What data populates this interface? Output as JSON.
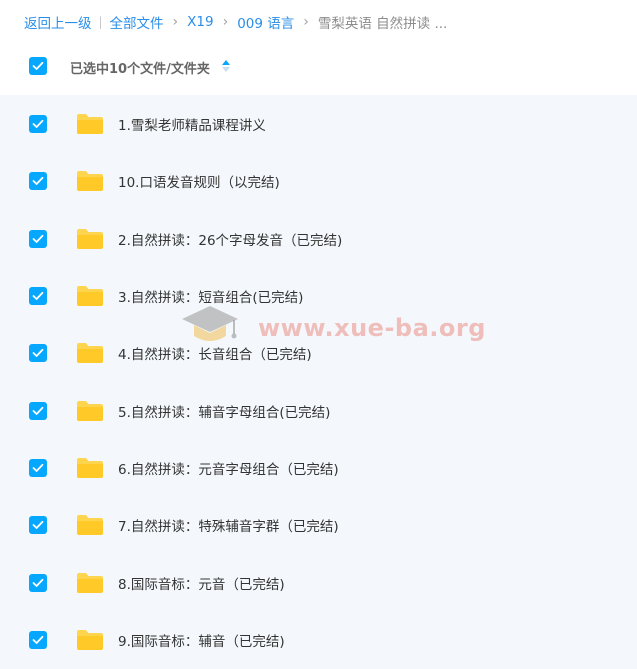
{
  "breadcrumb": {
    "back": "返回上一级",
    "all_files": "全部文件",
    "level1": "X19",
    "level2": "009 语言",
    "current": "雪梨英语 自然拼读 ..."
  },
  "selection": {
    "label": "已选中10个文件/文件夹",
    "checked": true
  },
  "files": [
    {
      "name": "1.雪梨老师精品课程讲义",
      "checked": true
    },
    {
      "name": "10.口语发音规则（以完结)",
      "checked": true
    },
    {
      "name": "2.自然拼读：26个字母发音（已完结)",
      "checked": true
    },
    {
      "name": "3.自然拼读：短音组合(已完结)",
      "checked": true
    },
    {
      "name": "4.自然拼读：长音组合（已完结)",
      "checked": true
    },
    {
      "name": "5.自然拼读：辅音字母组合(已完结)",
      "checked": true
    },
    {
      "name": "6.自然拼读：元音字母组合（已完结)",
      "checked": true
    },
    {
      "name": "7.自然拼读：特殊辅音字群（已完结)",
      "checked": true
    },
    {
      "name": "8.国际音标：元音（已完结)",
      "checked": true
    },
    {
      "name": "9.国际音标：辅音（已完结)",
      "checked": true
    }
  ],
  "watermark": {
    "text": "www.xue-ba.org",
    "icon": "graduation-cap-icon"
  },
  "colors": {
    "accent": "#06a7ff",
    "link": "#2a8ee8",
    "folder": "#ffd54f",
    "list_background": "#f4f8fc"
  }
}
